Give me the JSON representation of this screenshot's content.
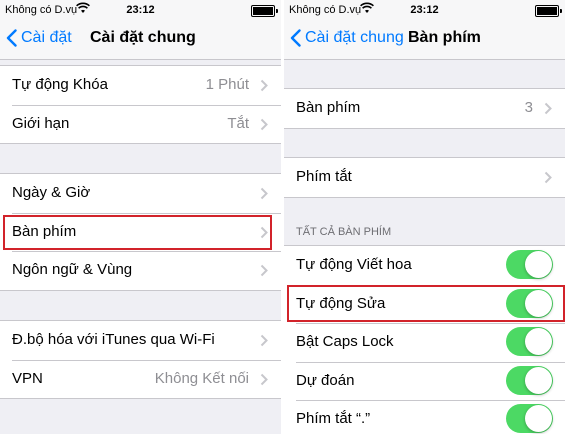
{
  "colors": {
    "accent": "#007aff",
    "toggle_on": "#4cd964",
    "highlight": "#d2232a",
    "value_gray": "#8e8e93"
  },
  "left": {
    "status": {
      "carrier": "Không có D.vụ",
      "time": "23:12"
    },
    "nav": {
      "back_label": "Cài đặt",
      "title": "Cài đặt chung"
    },
    "groups": [
      {
        "rows": [
          {
            "label": "Tự động Khóa",
            "value": "1 Phút"
          },
          {
            "label": "Giới hạn",
            "value": "Tắt"
          }
        ]
      },
      {
        "rows": [
          {
            "label": "Ngày & Giờ"
          },
          {
            "label": "Bàn phím",
            "highlighted": true
          },
          {
            "label": "Ngôn ngữ & Vùng"
          }
        ]
      },
      {
        "rows": [
          {
            "label": "Đ.bộ hóa với iTunes qua Wi-Fi"
          },
          {
            "label": "VPN",
            "value": "Không Kết nối"
          }
        ]
      }
    ]
  },
  "right": {
    "status": {
      "carrier": "Không có D.vụ",
      "time": "23:12"
    },
    "nav": {
      "back_label": "Cài đặt chung",
      "title": "Bàn phím"
    },
    "keyboards_row": {
      "label": "Bàn phím",
      "value": "3"
    },
    "shortcuts_row": {
      "label": "Phím tắt"
    },
    "section_header": "TẤT CẢ BÀN PHÍM",
    "toggles": [
      {
        "label": "Tự động Viết hoa",
        "on": true
      },
      {
        "label": "Tự động Sửa",
        "on": true,
        "highlighted": true
      },
      {
        "label": "Bật Caps Lock",
        "on": true
      },
      {
        "label": "Dự đoán",
        "on": true
      },
      {
        "label": "Phím tắt “.”",
        "on": true
      }
    ]
  },
  "icons": {
    "back": "chevron-left-icon",
    "disclosure": "chevron-right-icon",
    "wifi": "wifi-icon",
    "battery": "battery-icon"
  }
}
